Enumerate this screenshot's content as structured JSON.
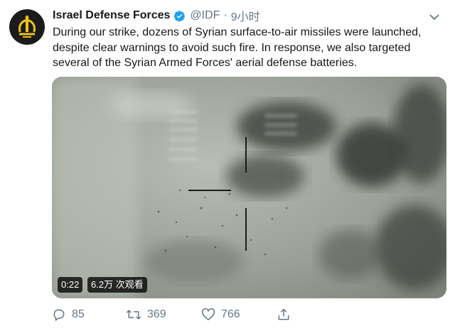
{
  "tweet": {
    "author_name": "Israel Defense Forces",
    "handle": "@IDF",
    "separator": "·",
    "time": "9小时",
    "text": "During our strike, dozens of Syrian surface-to-air missiles were launched, despite clear warnings to avoid such fire. In response, we also targeted several of the Syrian Armed Forces' aerial defense batteries."
  },
  "media": {
    "duration": "0:22",
    "views": "6.2万 次观看"
  },
  "actions": {
    "replies": "85",
    "retweets": "369",
    "likes": "766"
  },
  "icons": {
    "avatar": "idf-emblem-icon",
    "verified": "verified-badge-icon",
    "menu": "chevron-down-icon",
    "reply": "reply-icon",
    "retweet": "retweet-icon",
    "like": "heart-icon",
    "share": "share-icon"
  },
  "colors": {
    "accent": "#1da1f2",
    "muted": "#657786",
    "text": "#14171a"
  }
}
